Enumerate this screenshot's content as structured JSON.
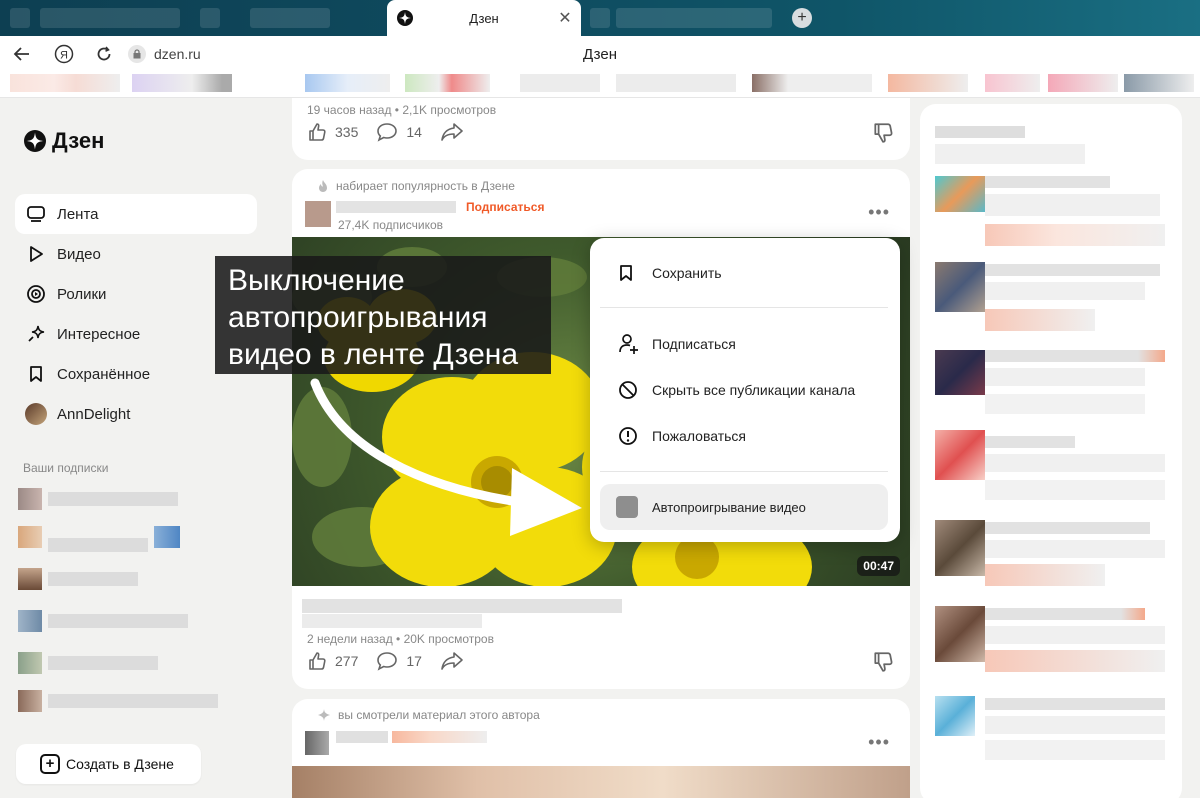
{
  "browser": {
    "active_tab_title": "Дзен",
    "url": "dzen.ru",
    "page_title": "Дзен",
    "new_tab_symbol": "+",
    "close_symbol": "✕"
  },
  "sidebar": {
    "logo_text": "Дзен",
    "items": [
      {
        "label": "Лента",
        "icon": "feed-icon"
      },
      {
        "label": "Видео",
        "icon": "play-icon"
      },
      {
        "label": "Ролики",
        "icon": "shorts-icon"
      },
      {
        "label": "Интересное",
        "icon": "sparkle-icon"
      },
      {
        "label": "Сохранённое",
        "icon": "bookmark-icon"
      },
      {
        "label": "AnnDelight",
        "icon": "avatar"
      }
    ],
    "subscriptions_title": "Ваши подписки",
    "create_button": "Создать в Дзене"
  },
  "feed": {
    "card1": {
      "meta": "19 часов назад • 2,1K просмотров",
      "likes": "335",
      "comments": "14"
    },
    "card2": {
      "popular": "набирает популярность в Дзене",
      "subscribe": "Подписаться",
      "subscribers": "27,4K подписчиков",
      "duration": "00:47",
      "meta": "2 недели назад • 20K просмотров",
      "likes": "277",
      "comments": "17"
    },
    "card3": {
      "note": "вы смотрели материал этого автора"
    }
  },
  "overlay_caption": [
    "Выключение",
    "автопроигрывания",
    "видео в ленте Дзена"
  ],
  "context_menu": {
    "save": "Сохранить",
    "subscribe": "Подписаться",
    "hide": "Скрыть все публикации канала",
    "report": "Пожаловаться",
    "autoplay": "Автопроигрывание видео"
  },
  "colors": {
    "accent": "#f05a28",
    "tabbar": "#0f4a5e"
  }
}
